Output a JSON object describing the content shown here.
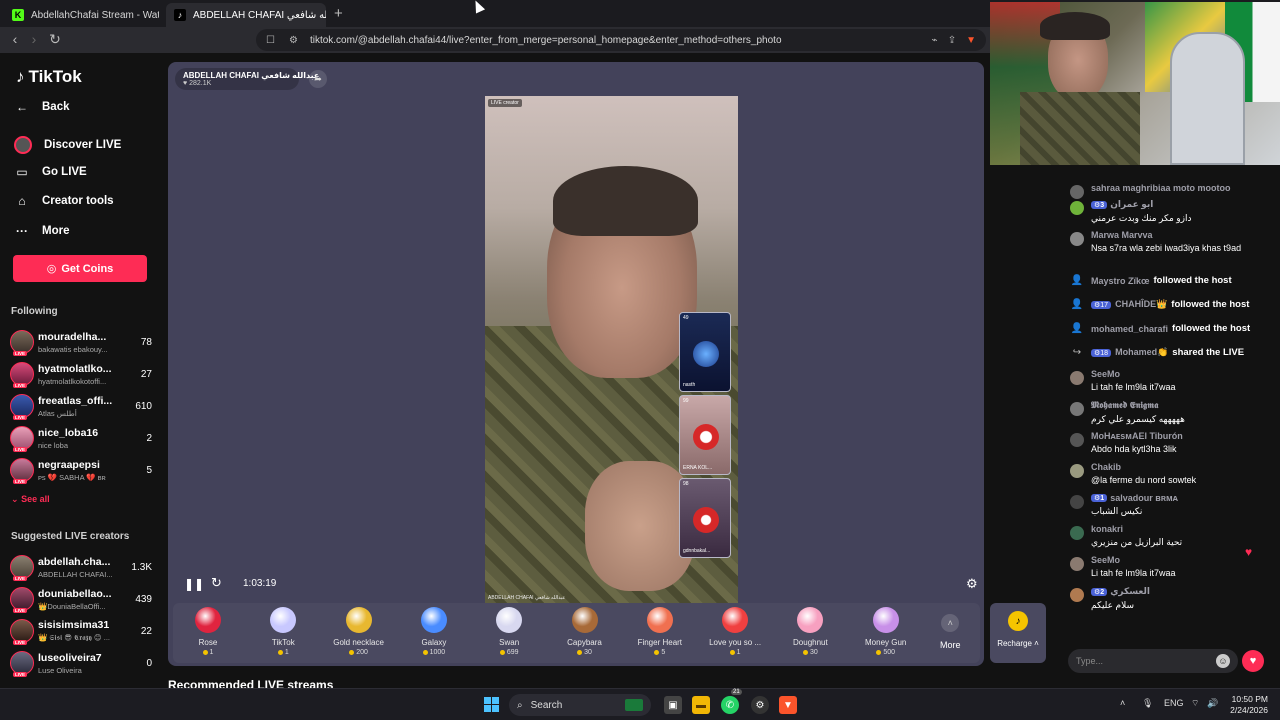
{
  "browser": {
    "tabs": [
      {
        "icon": "K",
        "title": "AbdellahChafai Stream - Watch Live o"
      },
      {
        "icon": "♪",
        "title": "ABDELLAH CHAFAI عبدالله شافعي"
      }
    ],
    "url": "tiktok.com/@abdellah.chafai44/live?enter_from_merge=personal_homepage&enter_method=others_photo"
  },
  "sidebar": {
    "logo": "TikTok",
    "back": "Back",
    "nav": [
      "Discover LIVE",
      "Go LIVE",
      "Creator tools",
      "More"
    ],
    "get_coins": "Get Coins",
    "following_heading": "Following",
    "following": [
      {
        "name": "mouradelha...",
        "sub": "bakawatis ebakouy...",
        "count": "78"
      },
      {
        "name": "hyatmolatlko...",
        "sub": "hyatmolatlkokotoffi...",
        "count": "27"
      },
      {
        "name": "freeatlas_offi...",
        "sub": "Atlas أطلس",
        "count": "610"
      },
      {
        "name": "nice_loba16",
        "sub": "nice loba",
        "count": "2"
      },
      {
        "name": "negraapepsi",
        "sub": "ᴘs 💔 SABHA 💔 ʙʀ",
        "count": "5"
      }
    ],
    "see_all": "See all",
    "suggested_heading": "Suggested LIVE creators",
    "suggested": [
      {
        "name": "abdellah.cha...",
        "sub": "ABDELLAH CHAFAI...",
        "count": "1.3K"
      },
      {
        "name": "douniabellao...",
        "sub": "👑DouniaBellaOffi...",
        "count": "439"
      },
      {
        "name": "sisisimsima31",
        "sub": "👑 𝕾𝖎𝖘𝖎 😎 𝕮𝖗𝖆𝖟𝖞 😊 ...",
        "count": "22"
      },
      {
        "name": "luseoliveira7",
        "sub": "Luse Oliveira",
        "count": "0"
      }
    ]
  },
  "player": {
    "host_name": "ABDELLAH CHAFAI عبدالله شافعي",
    "likes": "282.1K",
    "live_tag": "LIVE creator",
    "video_footer": "ABDELLAH CHAFAI عبدالله شافعي",
    "timer": "1:03:19",
    "guests": [
      {
        "num": "49",
        "name": "nasth"
      },
      {
        "num": "99",
        "name": "ERNA KOL..."
      },
      {
        "num": "98",
        "name": "gdnnbakal..."
      }
    ]
  },
  "gifts": [
    {
      "name": "Rose",
      "price": "1",
      "color": "#e0243f"
    },
    {
      "name": "TikTok",
      "price": "1",
      "color": "#c8c8ff"
    },
    {
      "name": "Gold necklace",
      "price": "200",
      "color": "#e8b830"
    },
    {
      "name": "Galaxy",
      "price": "1000",
      "color": "#4a8cff"
    },
    {
      "name": "Swan",
      "price": "699",
      "color": "#d8d8f0"
    },
    {
      "name": "Capybara",
      "price": "30",
      "color": "#a86a38"
    },
    {
      "name": "Finger Heart",
      "price": "5",
      "color": "#f07050"
    },
    {
      "name": "Love you so ...",
      "price": "1",
      "color": "#f04040"
    },
    {
      "name": "Doughnut",
      "price": "30",
      "color": "#f7a0c0"
    },
    {
      "name": "Money Gun",
      "price": "500",
      "color": "#c890e8"
    }
  ],
  "more_gifts": "More",
  "recharge": "Recharge ˄",
  "recommended_heading": "Recommended LIVE streams",
  "chat": {
    "messages": [
      {
        "user": "sahraa maghribiaa moto mootoo",
        "text": "",
        "avatar": "#666",
        "type": "partial"
      },
      {
        "user": "ابو عمران",
        "level": "3",
        "text": "دازو مكر منك وبدت عرمني",
        "avatar": "#6fb33a",
        "type": "msg"
      },
      {
        "user": "Marwa Marvva",
        "text": "Nsa s7ra wla zebi lwad3iya khas t9ad",
        "avatar": "#888",
        "type": "msg"
      },
      {
        "user": "Maystro Zïkœ",
        "text": "followed the host",
        "avatar": "👤",
        "type": "sys"
      },
      {
        "user": "CHAHÎDE👑",
        "level": "17",
        "text": "followed the host",
        "avatar": "👤",
        "type": "sys"
      },
      {
        "user": "mohamed_charafi",
        "text": "followed the host",
        "avatar": "👤",
        "type": "sys"
      },
      {
        "user": "Mohamed👏",
        "level": "18",
        "text": "shared the LIVE",
        "avatar": "↪",
        "type": "sys"
      },
      {
        "user": "SeeMo",
        "text": "Li tah fe lm9la it7waa",
        "avatar": "#8a7a70",
        "type": "msg"
      },
      {
        "user": "𝕸𝖔𝖍𝖆𝖒𝖊𝖉 𝕰𝖓𝖎𝖌𝖒𝖆",
        "text": "هههههه كيسمرو علي كرم",
        "avatar": "#777",
        "type": "msg"
      },
      {
        "user": "MoHᴀᴇsᴍAEl Tiburón",
        "text": "Abdo hda kytl3ha 3lik",
        "avatar": "#555",
        "type": "msg"
      },
      {
        "user": "Chakib",
        "text": "@la ferme du nord sowtek",
        "avatar": "#9a9a80",
        "type": "msg"
      },
      {
        "user": "salvadour ʙʀᴍᴀ",
        "level": "1",
        "text": "نكيس الشباب",
        "avatar": "#444",
        "type": "msg"
      },
      {
        "user": "konakri",
        "text": "تحية البرازيل من منزيري",
        "avatar": "#3a6a50",
        "type": "msg"
      },
      {
        "user": "SeeMo",
        "text": "Li tah fe lm9la it7waa",
        "avatar": "#8a7a70",
        "type": "msg"
      },
      {
        "user": "العسكري",
        "level": "2",
        "text": "سلام عليكم",
        "avatar": "#b07a50",
        "type": "msg"
      }
    ],
    "input_placeholder": "Type..."
  },
  "taskbar": {
    "search": "Search",
    "badge": "21",
    "lang": "ENG",
    "time": "10:50 PM",
    "date": "2/24/2026"
  }
}
